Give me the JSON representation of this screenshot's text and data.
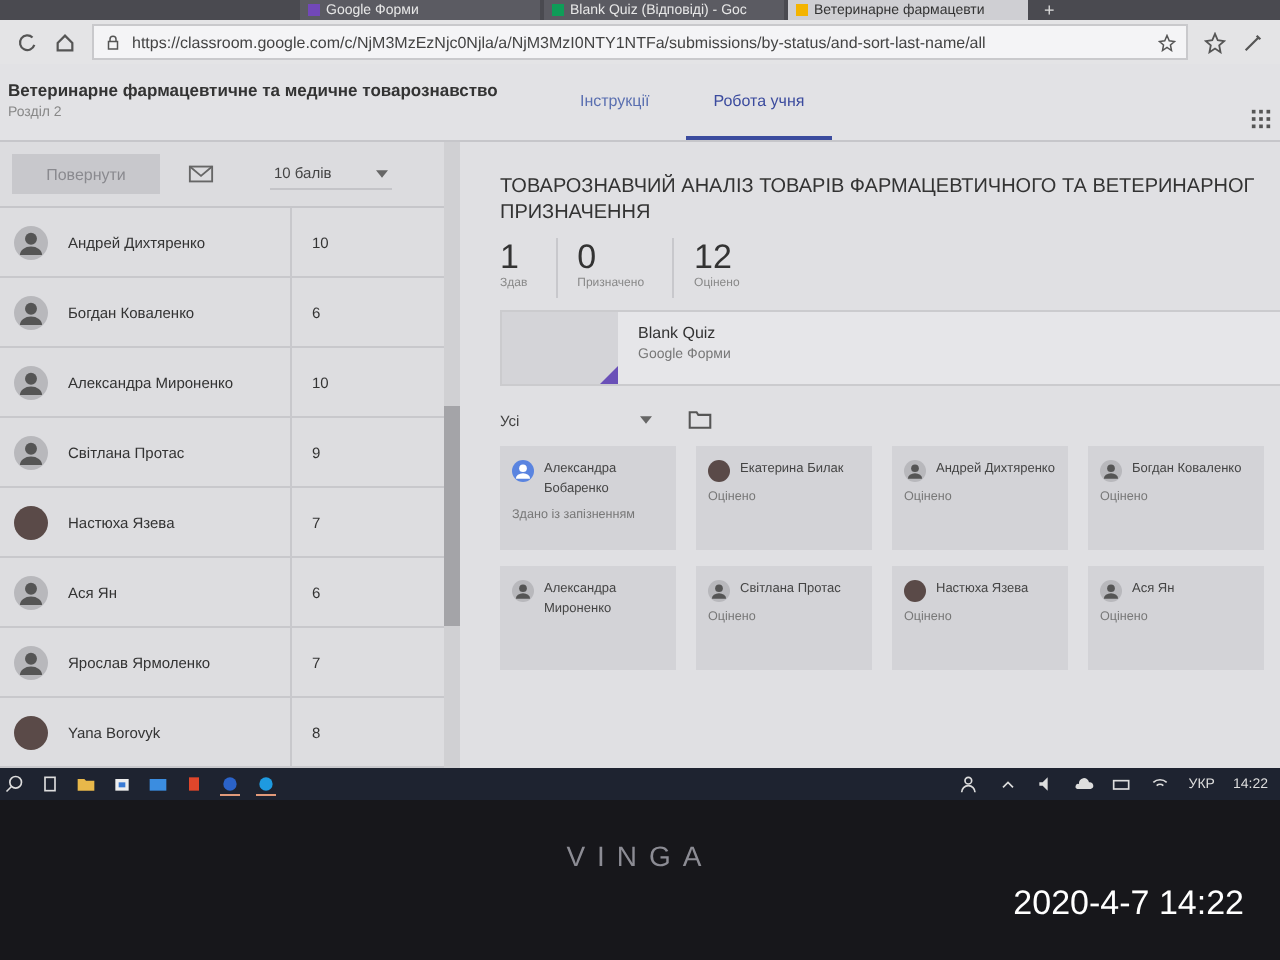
{
  "browser": {
    "tabs": [
      {
        "label": "Google Форми",
        "kind": "forms",
        "selected": false
      },
      {
        "label": "Blank Quiz (Відповіді) - Goc",
        "kind": "sheets",
        "selected": false
      },
      {
        "label": "Ветеринарне фармацевти",
        "kind": "drive",
        "selected": true
      }
    ],
    "new_tab": "+",
    "url": "https://classroom.google.com/c/NjM3MzEzNjc0Njla/a/NjM3MzI0NTY1NTFa/submissions/by-status/and-sort-last-name/all"
  },
  "header": {
    "title": "Ветеринарне фармацевтичне та медичне товарознавство",
    "subtitle": "Розділ 2",
    "tabs": [
      {
        "label": "Інструкції",
        "selected": false
      },
      {
        "label": "Робота учня",
        "selected": true
      }
    ]
  },
  "toolbar": {
    "return_button": {
      "label": "Повернути",
      "disabled": true
    },
    "points": "10 балів"
  },
  "students": [
    {
      "name": "Андрей Дихтяренко",
      "grade": "10",
      "kind": "default"
    },
    {
      "name": "Богдан Коваленко",
      "grade": "6",
      "kind": "default"
    },
    {
      "name": "Александра Мироненко",
      "grade": "10",
      "kind": "default"
    },
    {
      "name": "Світлана Протас",
      "grade": "9",
      "kind": "default"
    },
    {
      "name": "Настюха Язева",
      "grade": "7",
      "kind": "photo"
    },
    {
      "name": "Ася Ян",
      "grade": "6",
      "kind": "default"
    },
    {
      "name": "Ярослав Ярмоленко",
      "grade": "7",
      "kind": "default"
    },
    {
      "name": "Yana Borovyk",
      "grade": "8",
      "kind": "photo"
    }
  ],
  "assignment": {
    "title": "ТОВАРОЗНАВЧИЙ АНАЛІЗ ТОВАРІВ ФАРМАЦЕВТИЧНОГО ТА ВЕТЕРИНАРНОГ ПРИЗНАЧЕННЯ",
    "stats": [
      {
        "value": "1",
        "label": "Здав"
      },
      {
        "value": "0",
        "label": "Призначено"
      },
      {
        "value": "12",
        "label": "Оцінено"
      }
    ],
    "attachment": {
      "title": "Blank Quiz",
      "type": "Google Форми"
    },
    "filter": "Усі",
    "cards": [
      {
        "name": "Александра Бобаренко",
        "status": "Здано із запізненням",
        "kind": "blue"
      },
      {
        "name": "Екатерина Билак",
        "status": "Оцінено",
        "kind": "photo"
      },
      {
        "name": "Андрей Дихтяренко",
        "status": "Оцінено",
        "kind": "default"
      },
      {
        "name": "Богдан Коваленко",
        "status": "Оцінено",
        "kind": "default"
      },
      {
        "name": "Александра Мироненко",
        "kind": "default"
      },
      {
        "name": "Світлана Протас",
        "status": "Оцінено",
        "kind": "default"
      },
      {
        "name": "Настюха Язева",
        "status": "Оцінено",
        "kind": "photo"
      },
      {
        "name": "Ася Ян",
        "status": "Оцінено",
        "kind": "default"
      }
    ]
  },
  "taskbar": {
    "language": "УКР",
    "clock": "14:22"
  },
  "bezel": {
    "brand": "VINGA",
    "timestamp": "2020-4-7 14:22"
  }
}
